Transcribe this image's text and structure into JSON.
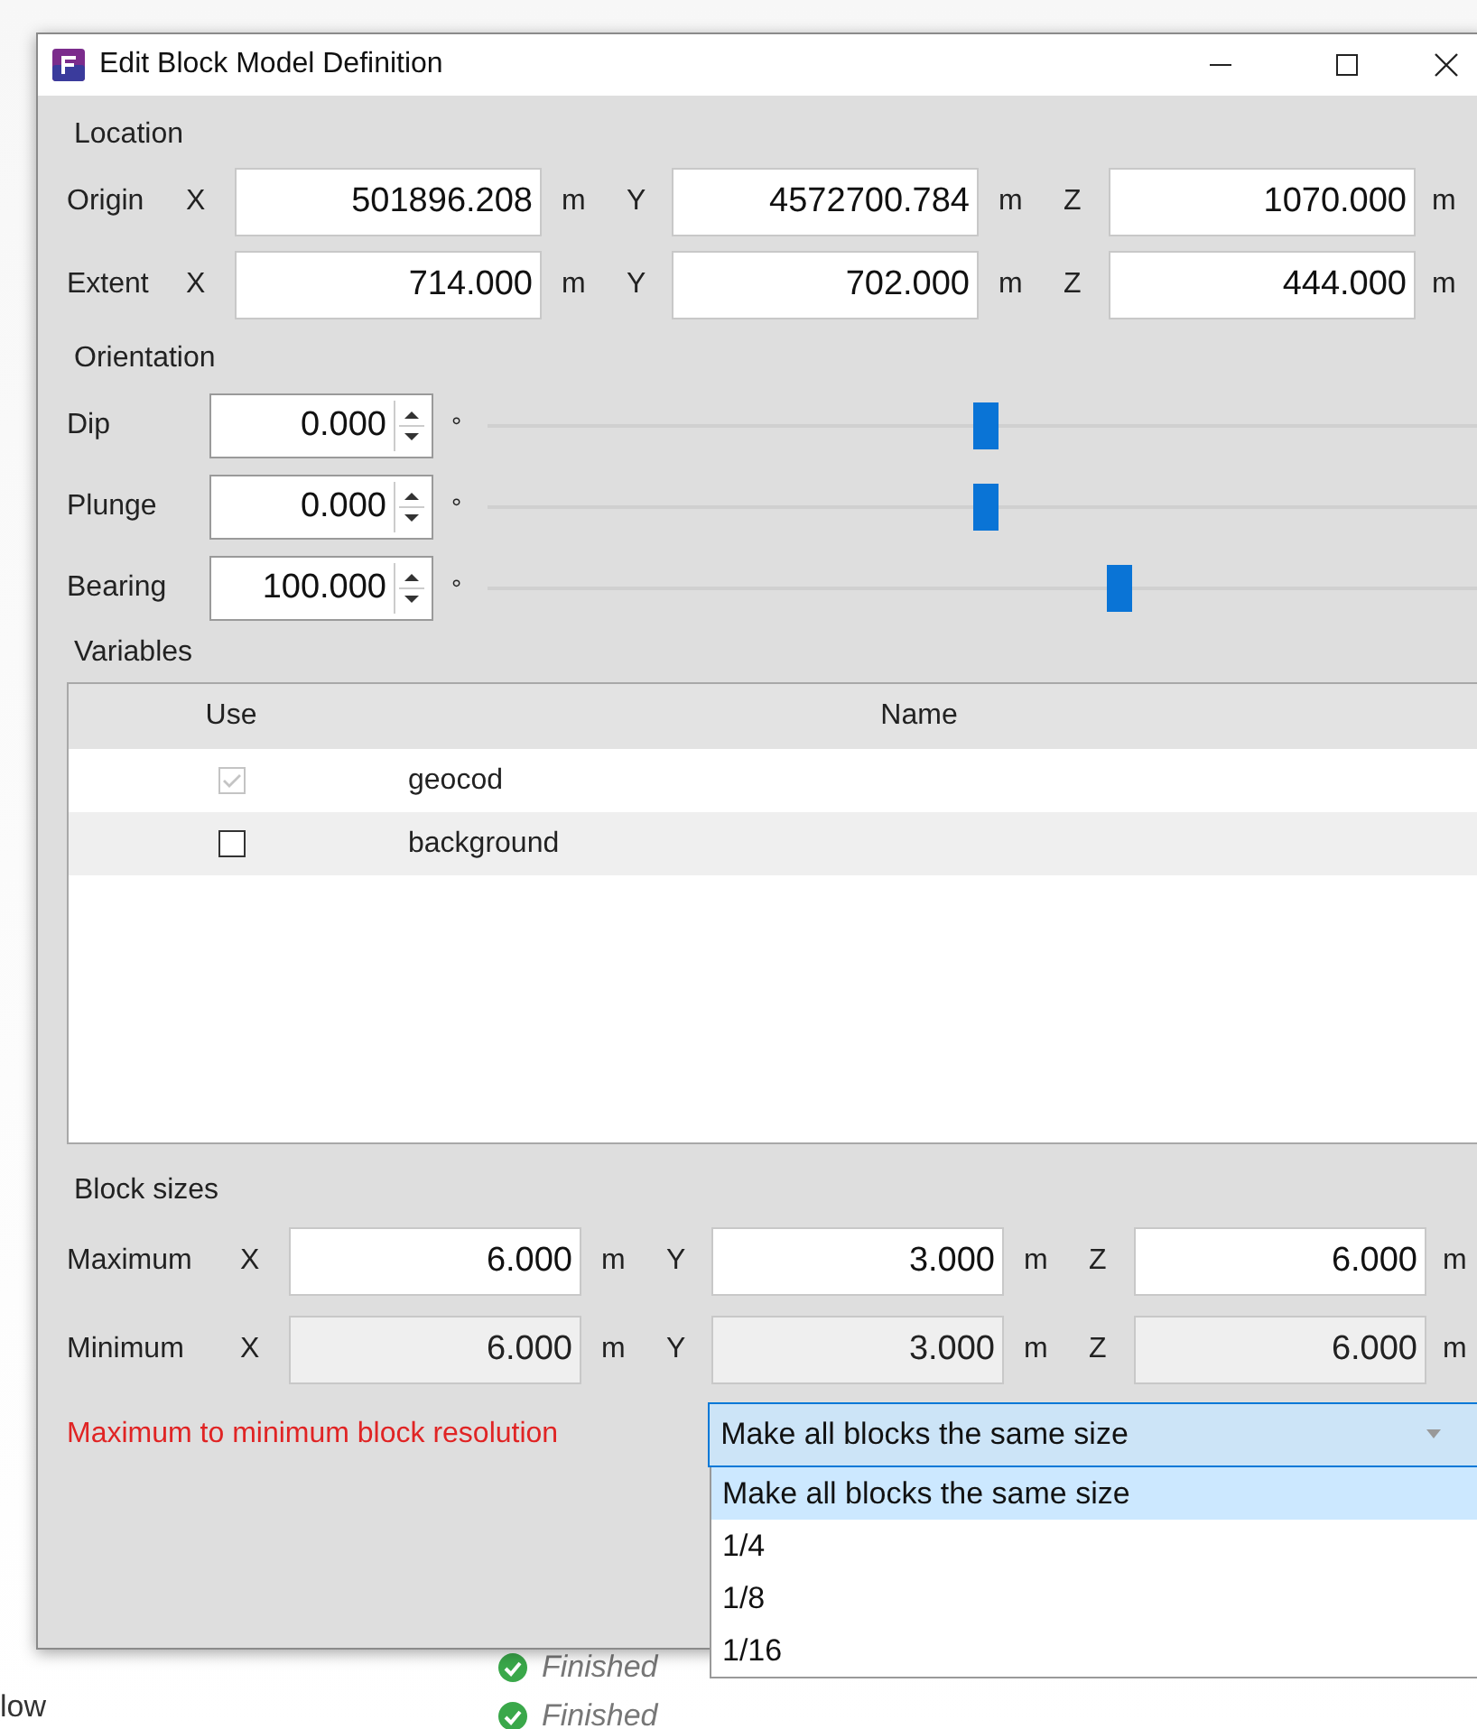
{
  "window": {
    "title": "Edit Block Model Definition"
  },
  "location": {
    "heading": "Location",
    "rows": [
      {
        "label": "Origin",
        "axes": [
          {
            "axis": "X",
            "value": "501896.208",
            "unit": "m"
          },
          {
            "axis": "Y",
            "value": "4572700.784",
            "unit": "m"
          },
          {
            "axis": "Z",
            "value": "1070.000",
            "unit": "m"
          }
        ]
      },
      {
        "label": "Extent",
        "axes": [
          {
            "axis": "X",
            "value": "714.000",
            "unit": "m"
          },
          {
            "axis": "Y",
            "value": "702.000",
            "unit": "m"
          },
          {
            "axis": "Z",
            "value": "444.000",
            "unit": "m"
          }
        ]
      }
    ]
  },
  "orientation": {
    "heading": "Orientation",
    "rows": [
      {
        "label": "Dip",
        "value": "0.000",
        "unit": "°",
        "level": 0.5
      },
      {
        "label": "Plunge",
        "value": "0.000",
        "unit": "°",
        "level": 0.5
      },
      {
        "label": "Bearing",
        "value": "100.000",
        "unit": "°",
        "level": 0.635
      }
    ]
  },
  "variables": {
    "heading": "Variables",
    "columns": [
      "Use",
      "Name"
    ],
    "rows": [
      {
        "checked": true,
        "disabled": true,
        "name": "geocod"
      },
      {
        "checked": false,
        "disabled": false,
        "name": "background"
      }
    ]
  },
  "block_sizes": {
    "heading": "Block sizes",
    "rows": [
      {
        "label": "Maximum",
        "disabled": false,
        "axes": [
          {
            "axis": "X",
            "value": "6.000",
            "unit": "m"
          },
          {
            "axis": "Y",
            "value": "3.000",
            "unit": "m"
          },
          {
            "axis": "Z",
            "value": "6.000",
            "unit": "m"
          }
        ]
      },
      {
        "label": "Minimum",
        "disabled": true,
        "axes": [
          {
            "axis": "X",
            "value": "6.000",
            "unit": "m"
          },
          {
            "axis": "Y",
            "value": "3.000",
            "unit": "m"
          },
          {
            "axis": "Z",
            "value": "6.000",
            "unit": "m"
          }
        ]
      }
    ]
  },
  "resolution": {
    "label": "Maximum to minimum block resolution",
    "error": true,
    "value": "Make all blocks the same size",
    "expanded": true,
    "options": [
      {
        "label": "Make all blocks the same size",
        "selected": true
      },
      {
        "label": "1/4",
        "selected": false
      },
      {
        "label": "1/8",
        "selected": false
      },
      {
        "label": "1/16",
        "selected": false
      }
    ]
  },
  "background": {
    "statuses": [
      {
        "text": "Finished"
      },
      {
        "text": "Finished"
      }
    ],
    "row_label": "low"
  }
}
